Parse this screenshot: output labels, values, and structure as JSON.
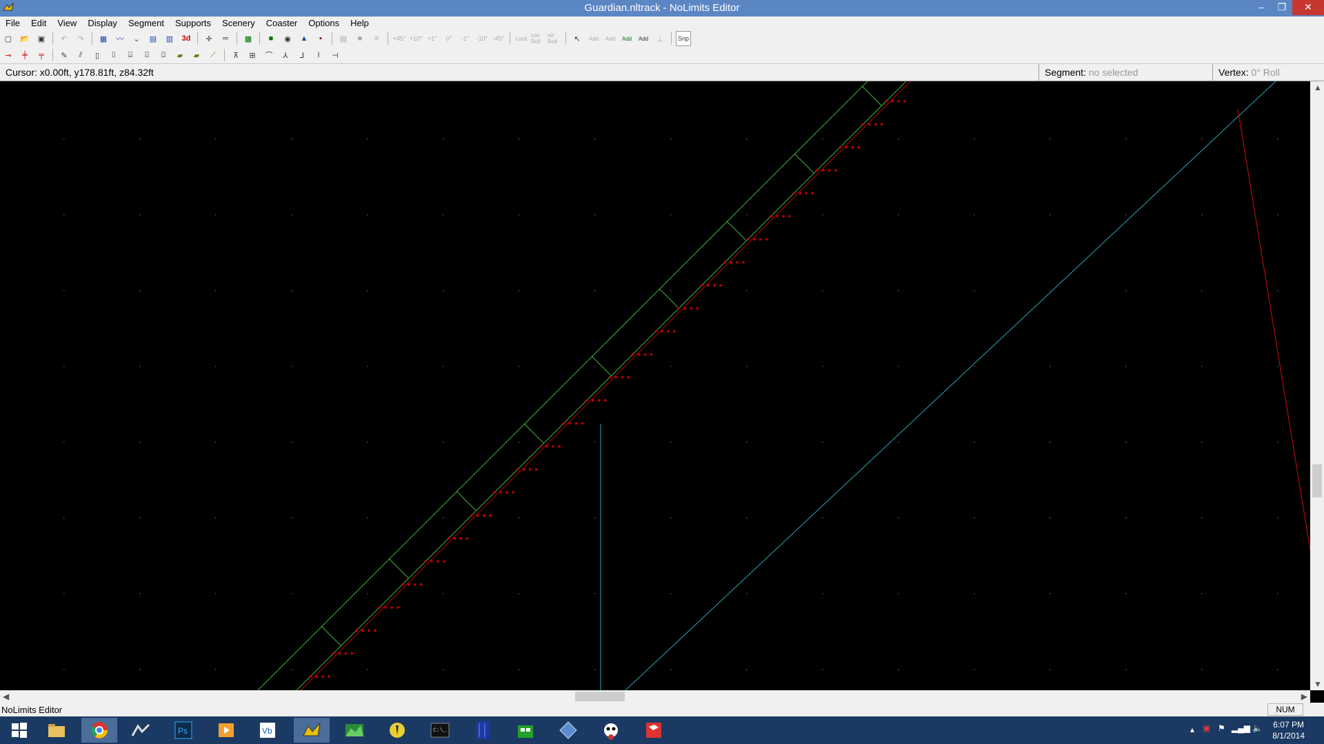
{
  "window": {
    "title": "Guardian.nltrack - NoLimits Editor"
  },
  "menu": [
    "File",
    "Edit",
    "View",
    "Display",
    "Segment",
    "Supports",
    "Scenery",
    "Coaster",
    "Options",
    "Help"
  ],
  "info": {
    "cursor_label": "Cursor:",
    "cursor_value": "x0.00ft, y178.81ft, z84.32ft",
    "segment_label": "Segment:",
    "segment_value": "no selected",
    "vertex_label": "Vertex:",
    "vertex_value": "0° Roll"
  },
  "toolbar": {
    "snap_label": "Snp",
    "roll_buttons": [
      "+45°",
      "+10°",
      "+1°",
      "0°",
      "-1°",
      "-10°",
      "-45°"
    ],
    "lock_labels": [
      "Lock",
      "con Roll",
      "rel Roll"
    ],
    "add_labels": [
      "Add",
      "Add",
      "Add",
      "Add"
    ]
  },
  "status": {
    "text": "NoLimits Editor",
    "num": "NUM"
  },
  "clock": {
    "time": "6:07 PM",
    "date": "8/1/2014"
  },
  "colors": {
    "track_green": "#3fb43f",
    "track_red": "#c00000",
    "cyan": "#2aa6b8",
    "red_line": "#d01010"
  }
}
